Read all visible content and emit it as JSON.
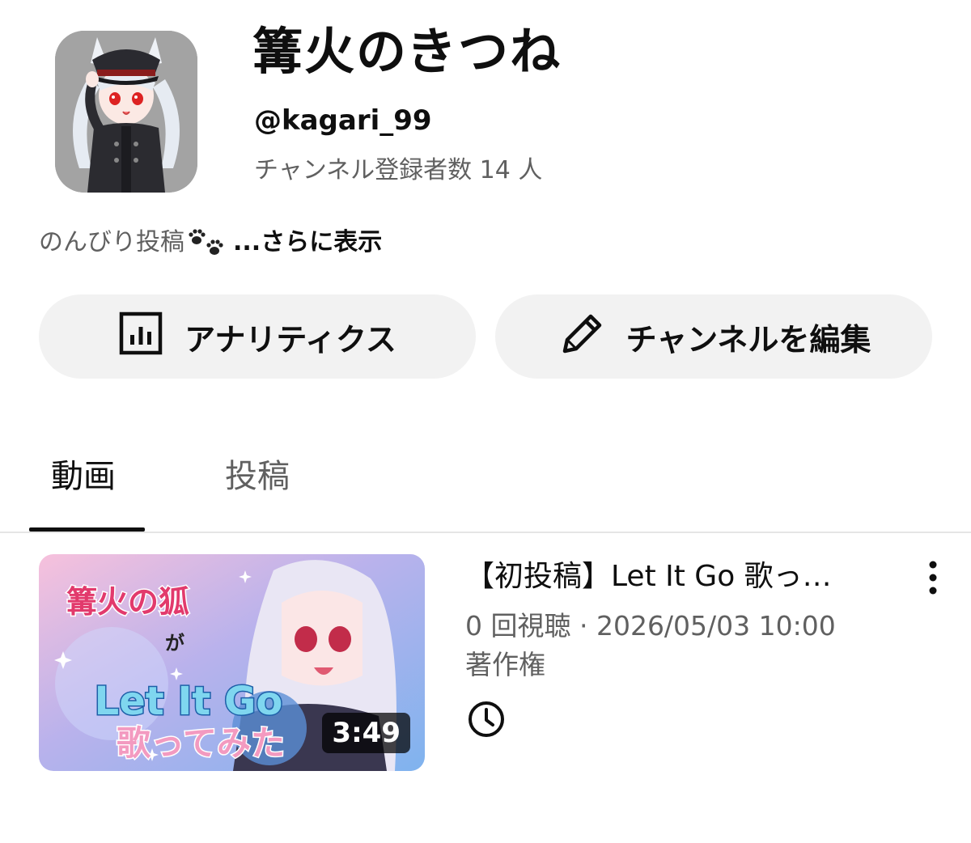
{
  "channel": {
    "name": "篝火のきつね",
    "handle": "@kagari_99",
    "subscribers": "チャンネル登録者数 14 人",
    "description": "のんびり投稿",
    "description_emoji": "paw-prints-icon",
    "more_label": "...さらに表示"
  },
  "buttons": {
    "analytics": "アナリティクス",
    "edit_channel": "チャンネルを編集"
  },
  "tabs": [
    {
      "label": "動画",
      "selected": true
    },
    {
      "label": "投稿",
      "selected": false
    }
  ],
  "videos": [
    {
      "title": "【初投稿】Let It Go 歌っ…",
      "meta": "0 回視聴 · 2026/05/03 10:00",
      "license": "著作権",
      "duration": "3:49",
      "thumbnail_text": {
        "line1": "篝火の狐",
        "line2": "が",
        "line3": "Let It Go",
        "line4": "歌ってみた"
      },
      "status_icon": "clock-icon"
    }
  ],
  "colors": {
    "text_primary": "#0f0f0f",
    "text_secondary": "#606060",
    "button_bg": "#f2f2f2",
    "divider": "#e5e5e5"
  }
}
